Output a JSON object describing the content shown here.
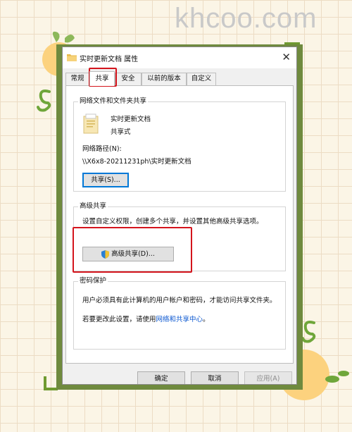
{
  "watermark": "khcoo.com",
  "dialog": {
    "title": "实时更新文档 属性",
    "close_label": "✕",
    "tabs": [
      {
        "label": "常规"
      },
      {
        "label": "共享"
      },
      {
        "label": "安全"
      },
      {
        "label": "以前的版本"
      },
      {
        "label": "自定义"
      }
    ],
    "active_tab": "共享",
    "network_sharing": {
      "group_title": "网络文件和文件夹共享",
      "folder_name": "实时更新文档",
      "share_status": "共享式",
      "path_label": "网络路径(N):",
      "path_value": "\\\\X6x8-20211231ph\\实时更新文档",
      "share_button": "共享(S)..."
    },
    "advanced_sharing": {
      "group_title": "高级共享",
      "description": "设置自定义权限，创建多个共享，并设置其他高级共享选项。",
      "button": "高级共享(D)..."
    },
    "password_protection": {
      "group_title": "密码保护",
      "description": "用户必须具有此计算机的用户帐户和密码，才能访问共享文件夹。",
      "change_prefix": "若要更改此设置，请使用",
      "change_link": "网络和共享中心",
      "change_suffix": "。"
    },
    "footer": {
      "ok": "确定",
      "cancel": "取消",
      "apply": "应用(A)"
    }
  },
  "colors": {
    "highlight_red": "#d4141c",
    "link_blue": "#0b57d0",
    "frame_green": "#6f8a3e",
    "accent_green": "#6f9a30"
  },
  "icons": {
    "title": "folder-icon",
    "group": "folder-icon",
    "advanced_button": "uac-shield-icon",
    "close": "close-icon"
  }
}
